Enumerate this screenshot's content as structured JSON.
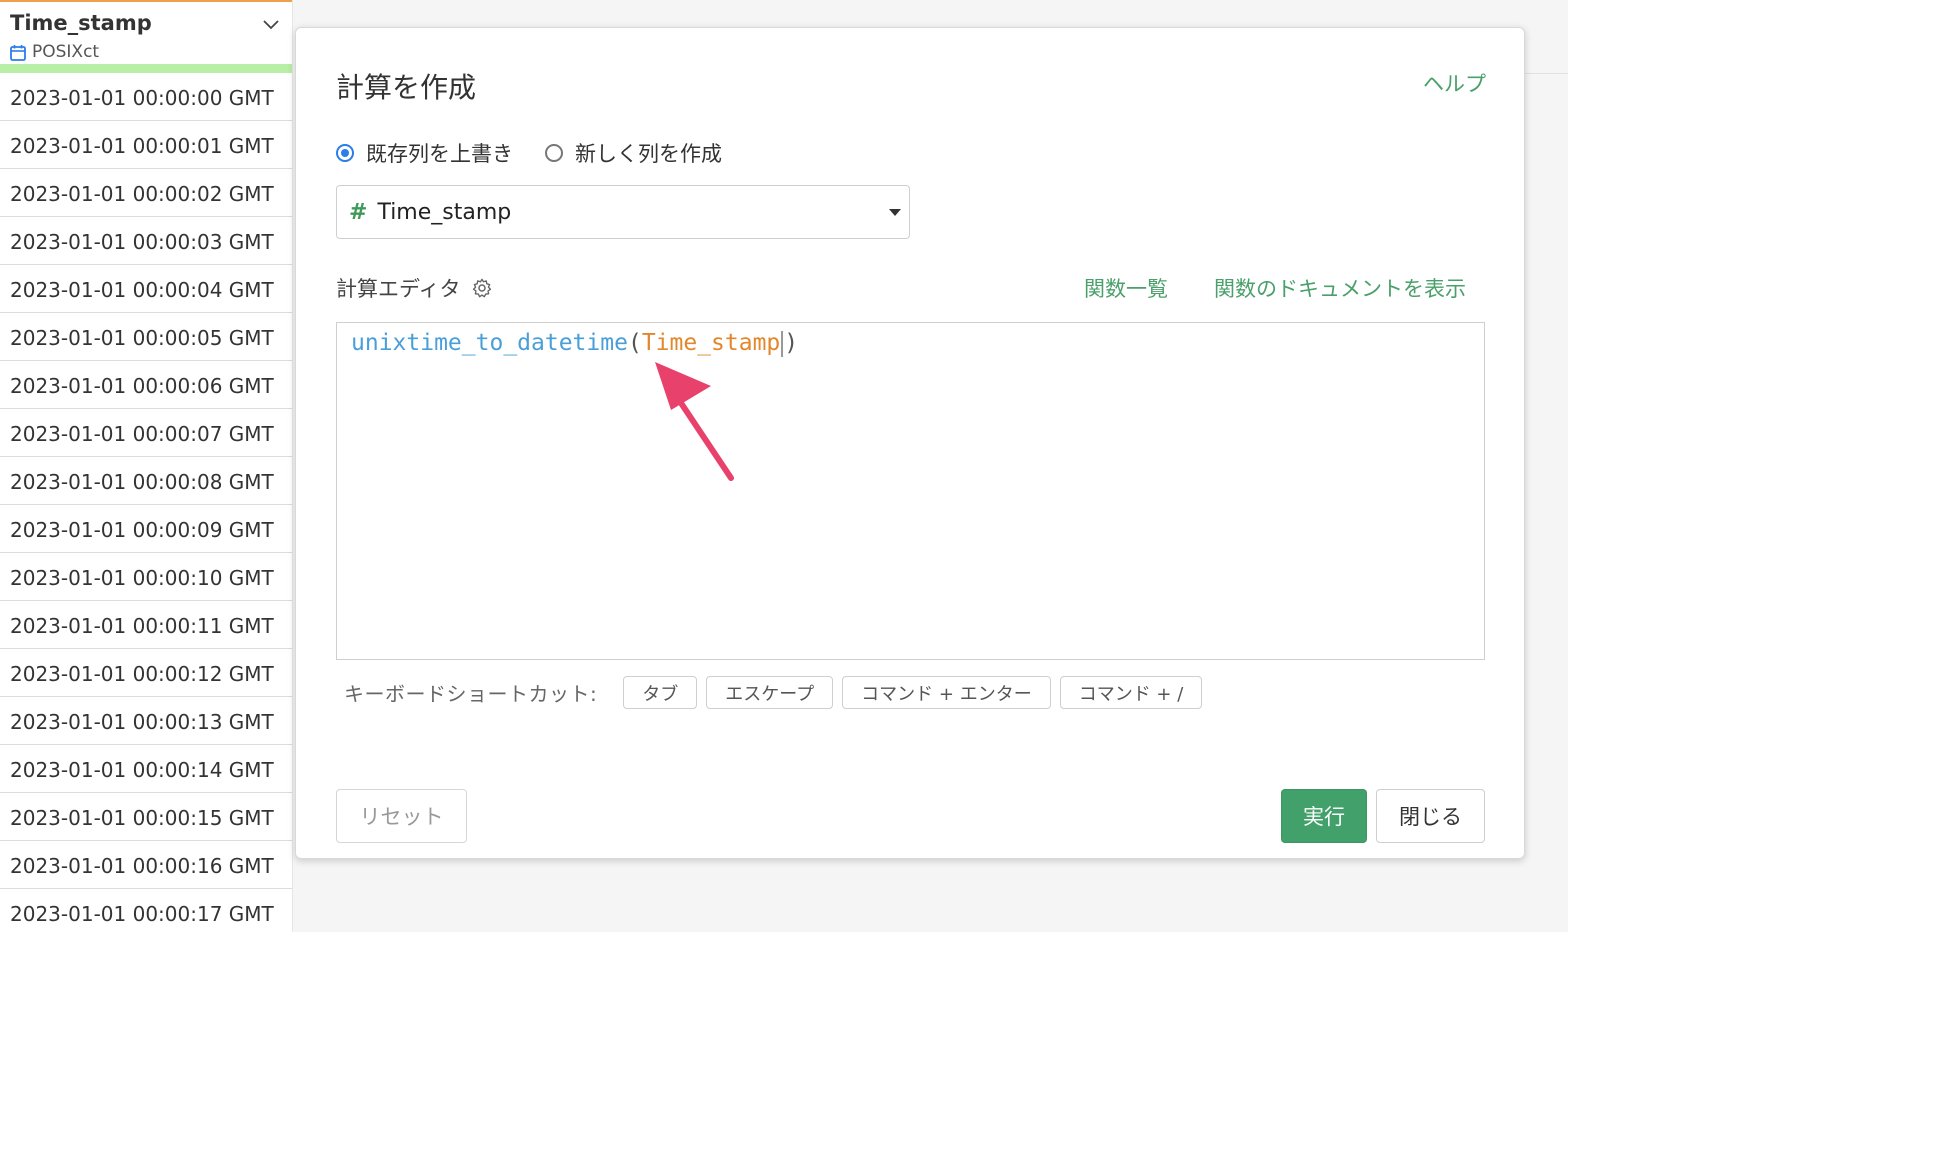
{
  "column": {
    "title": "Time_stamp",
    "type_label": "POSIXct",
    "rows": [
      "2023-01-01 00:00:00 GMT",
      "2023-01-01 00:00:01 GMT",
      "2023-01-01 00:00:02 GMT",
      "2023-01-01 00:00:03 GMT",
      "2023-01-01 00:00:04 GMT",
      "2023-01-01 00:00:05 GMT",
      "2023-01-01 00:00:06 GMT",
      "2023-01-01 00:00:07 GMT",
      "2023-01-01 00:00:08 GMT",
      "2023-01-01 00:00:09 GMT",
      "2023-01-01 00:00:10 GMT",
      "2023-01-01 00:00:11 GMT",
      "2023-01-01 00:00:12 GMT",
      "2023-01-01 00:00:13 GMT",
      "2023-01-01 00:00:14 GMT",
      "2023-01-01 00:00:15 GMT",
      "2023-01-01 00:00:16 GMT",
      "2023-01-01 00:00:17 GMT"
    ]
  },
  "dialog": {
    "title": "計算を作成",
    "help": "ヘルプ",
    "radio_overwrite": "既存列を上書き",
    "radio_new": "新しく列を作成",
    "select_value": "Time_stamp",
    "select_type_symbol": "#",
    "editor_label": "計算エディタ",
    "function_list": "関数一覧",
    "function_docs": "関数のドキュメントを表示",
    "code_function": "unixtime_to_datetime",
    "code_open": "(",
    "code_argument": "Time_stamp",
    "code_close": ")",
    "shortcuts_label": "キーボードショートカット:",
    "shortcuts": [
      "タブ",
      "エスケープ",
      "コマンド + エンター",
      "コマンド + /"
    ],
    "reset": "リセット",
    "run": "実行",
    "close": "閉じる"
  },
  "colors": {
    "accent_green": "#42a06a",
    "link_green": "#4aa06a",
    "radio_blue": "#2b7de9",
    "code_function": "#4a9fd9",
    "code_argument": "#e3872d",
    "arrow": "#e8416b",
    "header_bar": "#b9eea6"
  }
}
